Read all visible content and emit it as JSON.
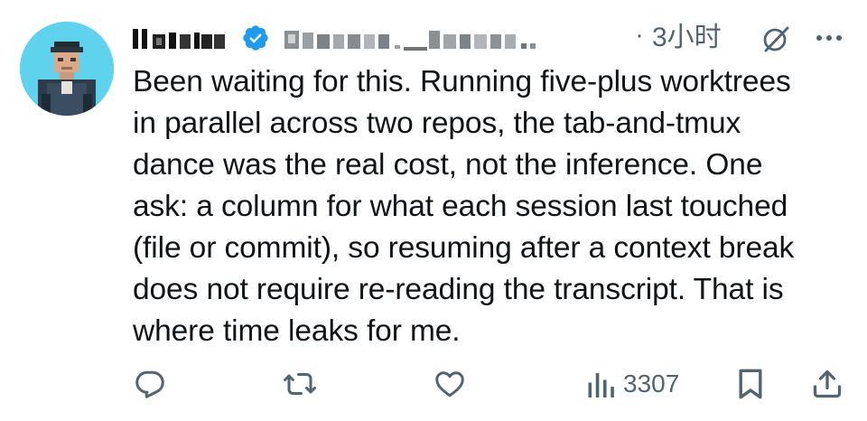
{
  "tweet": {
    "author_name_pixelated": "Ilana",
    "handle_pixelated": "@human_hana",
    "separator": "·",
    "time": "3小时",
    "text_lines": [
      "Been waiting for this. Running five-plus worktrees",
      "in parallel across two repos, the tab-and-tmux",
      "dance was the real cost, not the inference. One",
      "ask: a column for what each session last touched",
      "(file or commit), so resuming after a context break",
      "does not require re-reading the transcript. That is",
      "where time leaks for me."
    ],
    "views": "3307"
  },
  "icons": {
    "verified": "verified-badge-icon",
    "grok": "grok-icon",
    "more": "more-options-icon",
    "reply": "reply-icon",
    "repost": "repost-icon",
    "like": "like-icon",
    "views": "views-icon",
    "bookmark": "bookmark-icon",
    "share": "share-icon"
  },
  "colors": {
    "text": "#0f1419",
    "muted": "#536471",
    "verified_blue": "#1d9bf0",
    "avatar_bg": "#5fd3ee"
  }
}
